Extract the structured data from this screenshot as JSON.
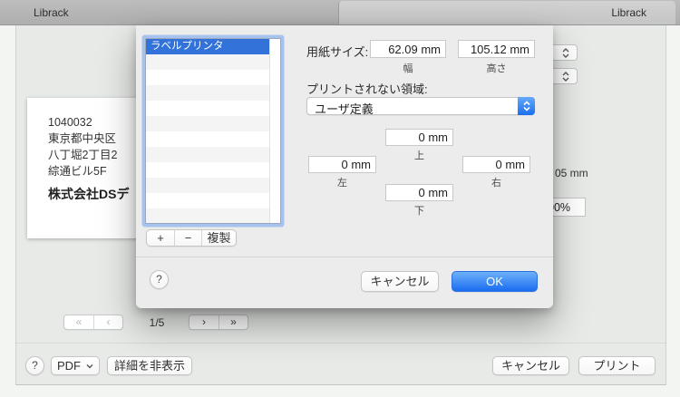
{
  "titlebar": {
    "left_title": "Librack",
    "right_title": "Librack"
  },
  "preview": {
    "address_lines": [
      "1040032",
      "東京都中央区",
      "八丁堀2丁目2",
      "綜通ビル5F"
    ],
    "company": "株式会社DSデ"
  },
  "pager": {
    "first": "«",
    "prev": "‹",
    "position": "1/5",
    "next": "›",
    "last": "»"
  },
  "background_controls": {
    "partial_mm": "05 mm",
    "partial_percent": "00%"
  },
  "sheet": {
    "list": {
      "items": [
        {
          "label": "ラベルプリンタ"
        }
      ]
    },
    "paper_size": {
      "label": "用紙サイズ:",
      "width_value": "62.09 mm",
      "width_caption": "幅",
      "height_value": "105.12 mm",
      "height_caption": "高さ"
    },
    "nonprintable": {
      "label": "プリントされない領域:",
      "selected_option": "ユーザ定義"
    },
    "margins": {
      "top_value": "0 mm",
      "top_caption": "上",
      "left_value": "0 mm",
      "left_caption": "左",
      "right_value": "0 mm",
      "right_caption": "右",
      "bottom_value": "0 mm",
      "bottom_caption": "下"
    },
    "actions": {
      "add": "+",
      "remove": "−",
      "duplicate": "複製"
    },
    "help": "?",
    "cancel": "キャンセル",
    "ok": "OK"
  },
  "footer": {
    "help": "?",
    "pdf": "PDF",
    "hide_details": "詳細を非表示",
    "cancel": "キャンセル",
    "print": "プリント"
  },
  "colors": {
    "accent_blue": "#1d6ef0",
    "selection_blue": "#3272d9",
    "sheet_bg": "#ececec",
    "window_bg": "#e7eae7"
  }
}
